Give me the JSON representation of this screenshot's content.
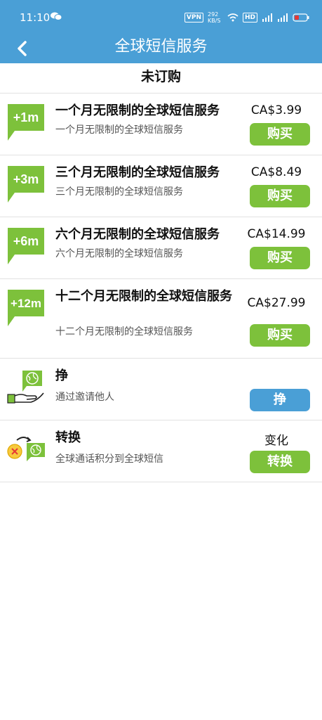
{
  "status_bar": {
    "time": "11:10",
    "icons": [
      "wechat-icon",
      "vpn-icon",
      "network-speed",
      "wifi-icon",
      "hd-icon",
      "signal-icon",
      "signal-icon",
      "battery-icon"
    ],
    "vpn": "VPN",
    "speed": "292 KB/S",
    "hd": "HD"
  },
  "app_bar": {
    "title": "全球短信服务",
    "back_icon": "chevron-left-icon"
  },
  "section": {
    "title": "未订购"
  },
  "colors": {
    "accent_blue": "#4a9fd6",
    "accent_green": "#7dc13b"
  },
  "plans": [
    {
      "badge": "+1m",
      "name": "一个月无限制的全球短信服务",
      "desc": "一个月无限制的全球短信服务",
      "price": "CA$3.99",
      "button": "购买"
    },
    {
      "badge": "+3m",
      "name": "三个月无限制的全球短信服务",
      "desc": "三个月无限制的全球短信服务",
      "price": "CA$8.49",
      "button": "购买"
    },
    {
      "badge": "+6m",
      "name": "六个月无限制的全球短信服务",
      "desc": "六个月无限制的全球短信服务",
      "price": "CA$14.99",
      "button": "购买"
    },
    {
      "badge": "+12m",
      "name": "十二个月无限制的全球短信服务",
      "desc": "十二个月无限制的全球短信服务",
      "price": "CA$27.99",
      "button": "购买"
    }
  ],
  "earn": {
    "name": "挣",
    "desc": "通过邀请他人",
    "button": "挣",
    "icon": "hand-globe-icon"
  },
  "convert": {
    "name": "转换",
    "desc": "全球通话积分到全球短信",
    "label": "变化",
    "button": "转换",
    "icon": "coin-to-globe-icon"
  }
}
